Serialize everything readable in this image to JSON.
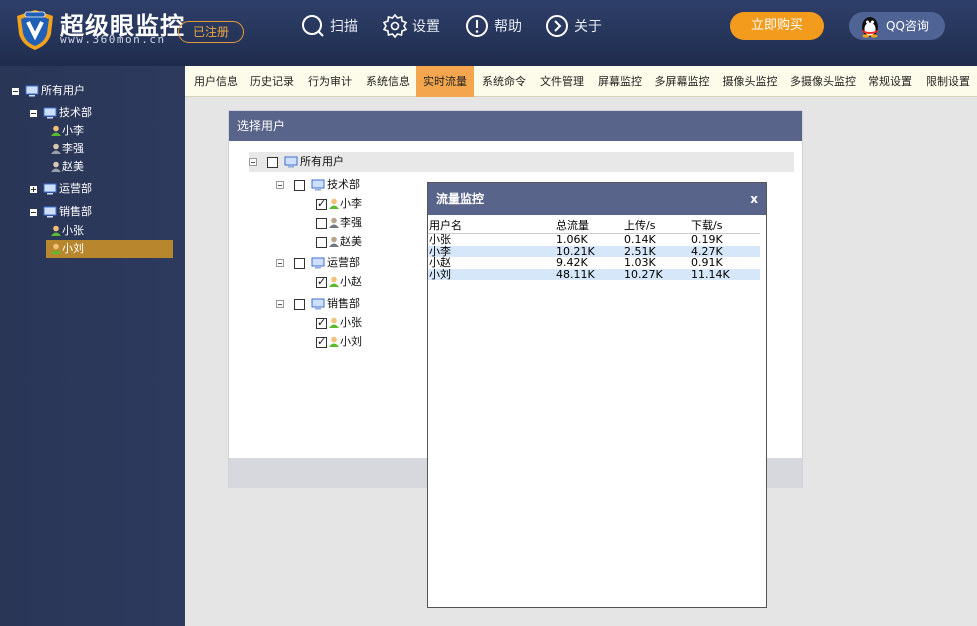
{
  "header": {
    "app_title": "超级眼监控",
    "site_url": "www.360mon.cn",
    "reg_badge": "已注册",
    "nav": [
      {
        "label": "扫描",
        "icon": "scan-icon"
      },
      {
        "label": "设置",
        "icon": "gear-icon"
      },
      {
        "label": "帮助",
        "icon": "help-icon"
      },
      {
        "label": "关于",
        "icon": "about-icon"
      }
    ],
    "buy_label": "立即购买",
    "qq_label": "QQ咨询",
    "colors": {
      "header_bg": "#26355a",
      "buy_bg": "#f29b1c",
      "qq_bg": "#4f6394"
    }
  },
  "sidebar": {
    "root": "所有用户",
    "groups": [
      {
        "name": "技术部",
        "users": [
          "小李",
          "李强",
          "赵美"
        ]
      },
      {
        "name": "运营部",
        "users": []
      },
      {
        "name": "销售部",
        "users": [
          "小张",
          "小刘"
        ]
      }
    ],
    "selected": "小刘",
    "selected_color": "#b8862d"
  },
  "tabs": {
    "items": [
      "用户信息",
      "历史记录",
      "行为审计",
      "系统信息",
      "实时流量",
      "系统命令",
      "文件管理",
      "屏幕监控",
      "多屏幕监控",
      "摄像头监控",
      "多摄像头监控",
      "常规设置",
      "限制设置"
    ],
    "active": "实时流量",
    "active_color": "#f3a64d"
  },
  "panel": {
    "title": "选择用户",
    "tree": {
      "root": "所有用户",
      "groups": [
        {
          "name": "技术部",
          "users": [
            {
              "name": "小李",
              "checked": true
            },
            {
              "name": "李强",
              "checked": false
            },
            {
              "name": "赵美",
              "checked": false
            }
          ]
        },
        {
          "name": "运营部",
          "users": [
            {
              "name": "小赵",
              "checked": true
            }
          ]
        },
        {
          "name": "销售部",
          "users": [
            {
              "name": "小张",
              "checked": true
            },
            {
              "name": "小刘",
              "checked": true
            }
          ]
        }
      ]
    }
  },
  "traffic_dialog": {
    "title": "流量监控",
    "close_label": "x",
    "columns": [
      "用户名",
      "总流量",
      "上传/s",
      "下载/s"
    ],
    "rows": [
      [
        "小张",
        "1.06K",
        "0.14K",
        "0.19K"
      ],
      [
        "小李",
        "10.21K",
        "2.51K",
        "4.27K"
      ],
      [
        "小赵",
        "9.42K",
        "1.03K",
        "0.91K"
      ],
      [
        "小刘",
        "48.11K",
        "10.27K",
        "11.14K"
      ]
    ],
    "row_highlight_color": "#d5e7f8"
  }
}
